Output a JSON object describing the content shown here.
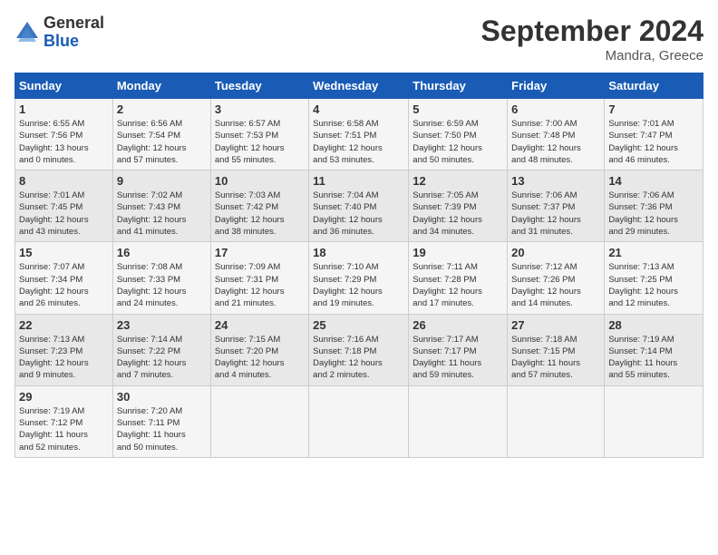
{
  "logo": {
    "general": "General",
    "blue": "Blue"
  },
  "title": "September 2024",
  "location": "Mandra, Greece",
  "days_header": [
    "Sunday",
    "Monday",
    "Tuesday",
    "Wednesday",
    "Thursday",
    "Friday",
    "Saturday"
  ],
  "weeks": [
    [
      {
        "day": "1",
        "info": "Sunrise: 6:55 AM\nSunset: 7:56 PM\nDaylight: 13 hours\nand 0 minutes."
      },
      {
        "day": "2",
        "info": "Sunrise: 6:56 AM\nSunset: 7:54 PM\nDaylight: 12 hours\nand 57 minutes."
      },
      {
        "day": "3",
        "info": "Sunrise: 6:57 AM\nSunset: 7:53 PM\nDaylight: 12 hours\nand 55 minutes."
      },
      {
        "day": "4",
        "info": "Sunrise: 6:58 AM\nSunset: 7:51 PM\nDaylight: 12 hours\nand 53 minutes."
      },
      {
        "day": "5",
        "info": "Sunrise: 6:59 AM\nSunset: 7:50 PM\nDaylight: 12 hours\nand 50 minutes."
      },
      {
        "day": "6",
        "info": "Sunrise: 7:00 AM\nSunset: 7:48 PM\nDaylight: 12 hours\nand 48 minutes."
      },
      {
        "day": "7",
        "info": "Sunrise: 7:01 AM\nSunset: 7:47 PM\nDaylight: 12 hours\nand 46 minutes."
      }
    ],
    [
      {
        "day": "8",
        "info": "Sunrise: 7:01 AM\nSunset: 7:45 PM\nDaylight: 12 hours\nand 43 minutes."
      },
      {
        "day": "9",
        "info": "Sunrise: 7:02 AM\nSunset: 7:43 PM\nDaylight: 12 hours\nand 41 minutes."
      },
      {
        "day": "10",
        "info": "Sunrise: 7:03 AM\nSunset: 7:42 PM\nDaylight: 12 hours\nand 38 minutes."
      },
      {
        "day": "11",
        "info": "Sunrise: 7:04 AM\nSunset: 7:40 PM\nDaylight: 12 hours\nand 36 minutes."
      },
      {
        "day": "12",
        "info": "Sunrise: 7:05 AM\nSunset: 7:39 PM\nDaylight: 12 hours\nand 34 minutes."
      },
      {
        "day": "13",
        "info": "Sunrise: 7:06 AM\nSunset: 7:37 PM\nDaylight: 12 hours\nand 31 minutes."
      },
      {
        "day": "14",
        "info": "Sunrise: 7:06 AM\nSunset: 7:36 PM\nDaylight: 12 hours\nand 29 minutes."
      }
    ],
    [
      {
        "day": "15",
        "info": "Sunrise: 7:07 AM\nSunset: 7:34 PM\nDaylight: 12 hours\nand 26 minutes."
      },
      {
        "day": "16",
        "info": "Sunrise: 7:08 AM\nSunset: 7:33 PM\nDaylight: 12 hours\nand 24 minutes."
      },
      {
        "day": "17",
        "info": "Sunrise: 7:09 AM\nSunset: 7:31 PM\nDaylight: 12 hours\nand 21 minutes."
      },
      {
        "day": "18",
        "info": "Sunrise: 7:10 AM\nSunset: 7:29 PM\nDaylight: 12 hours\nand 19 minutes."
      },
      {
        "day": "19",
        "info": "Sunrise: 7:11 AM\nSunset: 7:28 PM\nDaylight: 12 hours\nand 17 minutes."
      },
      {
        "day": "20",
        "info": "Sunrise: 7:12 AM\nSunset: 7:26 PM\nDaylight: 12 hours\nand 14 minutes."
      },
      {
        "day": "21",
        "info": "Sunrise: 7:13 AM\nSunset: 7:25 PM\nDaylight: 12 hours\nand 12 minutes."
      }
    ],
    [
      {
        "day": "22",
        "info": "Sunrise: 7:13 AM\nSunset: 7:23 PM\nDaylight: 12 hours\nand 9 minutes."
      },
      {
        "day": "23",
        "info": "Sunrise: 7:14 AM\nSunset: 7:22 PM\nDaylight: 12 hours\nand 7 minutes."
      },
      {
        "day": "24",
        "info": "Sunrise: 7:15 AM\nSunset: 7:20 PM\nDaylight: 12 hours\nand 4 minutes."
      },
      {
        "day": "25",
        "info": "Sunrise: 7:16 AM\nSunset: 7:18 PM\nDaylight: 12 hours\nand 2 minutes."
      },
      {
        "day": "26",
        "info": "Sunrise: 7:17 AM\nSunset: 7:17 PM\nDaylight: 11 hours\nand 59 minutes."
      },
      {
        "day": "27",
        "info": "Sunrise: 7:18 AM\nSunset: 7:15 PM\nDaylight: 11 hours\nand 57 minutes."
      },
      {
        "day": "28",
        "info": "Sunrise: 7:19 AM\nSunset: 7:14 PM\nDaylight: 11 hours\nand 55 minutes."
      }
    ],
    [
      {
        "day": "29",
        "info": "Sunrise: 7:19 AM\nSunset: 7:12 PM\nDaylight: 11 hours\nand 52 minutes."
      },
      {
        "day": "30",
        "info": "Sunrise: 7:20 AM\nSunset: 7:11 PM\nDaylight: 11 hours\nand 50 minutes."
      },
      {
        "day": "",
        "info": ""
      },
      {
        "day": "",
        "info": ""
      },
      {
        "day": "",
        "info": ""
      },
      {
        "day": "",
        "info": ""
      },
      {
        "day": "",
        "info": ""
      }
    ]
  ]
}
